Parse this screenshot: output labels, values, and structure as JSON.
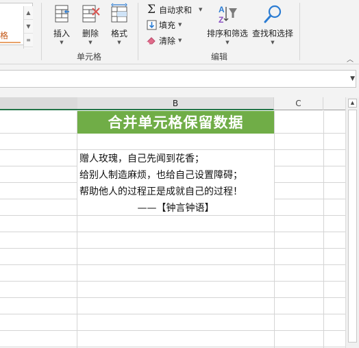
{
  "ribbon": {
    "styles_gallery": {
      "swatch_text": "格"
    },
    "cells_group": {
      "label": "单元格",
      "insert": "插入",
      "delete": "删除",
      "format": "格式"
    },
    "editing_group": {
      "label": "编辑",
      "autosum": "自动求和",
      "fill": "填充",
      "clear": "清除",
      "sort_filter": "排序和筛选",
      "find_select": "查找和选择"
    }
  },
  "sheet": {
    "columns": [
      "B",
      "C"
    ],
    "title": "合并单元格保留数据",
    "poem": [
      "赠人玫瑰，自己先闻到花香；",
      "给别人制造麻烦，也给自己设置障碍；",
      "帮助他人的过程正是成就自己的过程！"
    ],
    "attribution": "——【钟言钟语】"
  },
  "colors": {
    "title_fill": "#70ad47",
    "title_text": "#ffffff",
    "excel_green": "#217346",
    "delete_x": "#d9534f",
    "clear_eraser": "#e06c8a"
  }
}
